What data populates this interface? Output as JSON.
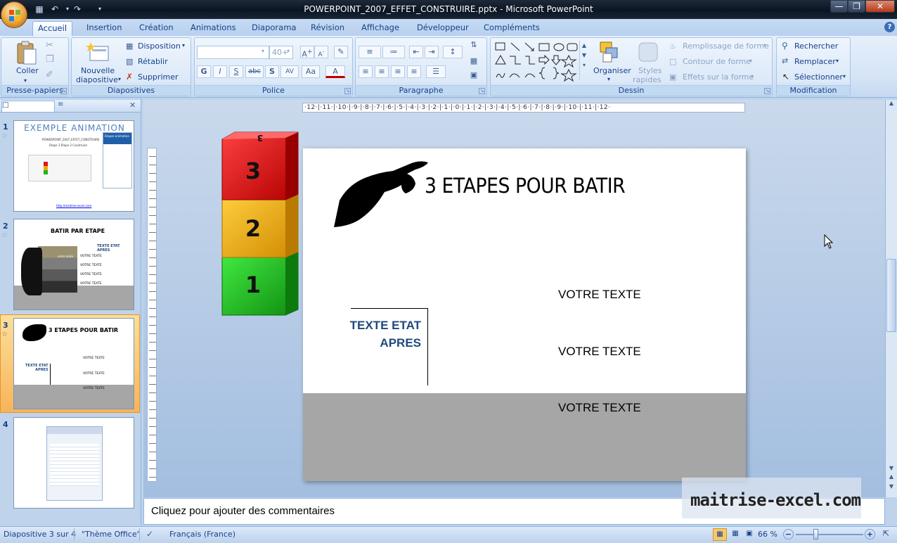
{
  "window": {
    "title": "POWERPOINT_2007_EFFET_CONSTRUIRE.pptx - Microsoft PowerPoint"
  },
  "tabs": [
    "Accueil",
    "Insertion",
    "Création",
    "Animations",
    "Diaporama",
    "Révision",
    "Affichage",
    "Développeur",
    "Compléments"
  ],
  "ribbon": {
    "clipboard": {
      "label": "Presse-papiers",
      "paste": "Coller"
    },
    "slides": {
      "label": "Diapositives",
      "new_slide_1": "Nouvelle",
      "new_slide_2": "diapositive",
      "layout": "Disposition",
      "reset": "Rétablir",
      "delete": "Supprimer"
    },
    "font": {
      "label": "Police",
      "size": "40+"
    },
    "paragraph": {
      "label": "Paragraphe"
    },
    "drawing": {
      "label": "Dessin",
      "arrange": "Organiser",
      "styles_1": "Styles",
      "styles_2": "rapides",
      "fill": "Remplissage de forme",
      "outline": "Contour de forme",
      "effects": "Effets sur la forme"
    },
    "editing": {
      "label": "Modification",
      "find": "Rechercher",
      "replace": "Remplacer",
      "select": "Sélectionner"
    }
  },
  "thumbnails": {
    "t1": {
      "num": "1",
      "title": "EXEMPLE ANIMATION",
      "sub1": "POWERPOINT_2007_EFFET_CONSTRUIRE",
      "sub2": "Etape  1  Etape  2  Construire",
      "box": "Etapes animation",
      "link": "http://maitrise-excel.com"
    },
    "t2": {
      "num": "2",
      "title": "BATIR PAR ETAPE",
      "right": "TEXTE ETAT APRES",
      "items": [
        "VOTRE TEXTE",
        "VOTRE TEXTE",
        "VOTRE TEXTE",
        "VOTRE TEXTE"
      ],
      "block": "votre texte"
    },
    "t3": {
      "num": "3",
      "title": "3 ETAPES POUR BATIR",
      "left1": "TEXTE ETAT",
      "left2": "APRES",
      "items": [
        "VOTRE TEXTE",
        "VOTRE TEXTE",
        "VOTRE TEXTE"
      ]
    },
    "t4": {
      "num": "4"
    }
  },
  "slide": {
    "title": "3 ETAPES POUR BATIR",
    "left_text_1": "TEXTE ETAT",
    "left_text_2": "APRES",
    "text1": "VOTRE TEXTE",
    "text2": "VOTRE TEXTE",
    "text3": "VOTRE TEXTE",
    "cubes": [
      "3",
      "2",
      "1"
    ]
  },
  "ruler": {
    "h": "·12·|·11·|·10·|·9·|·8·|·7·|·6·|·5·|·4·|·3·|·2·|·1·|·0·|·1·|·2·|·3·|·4·|·5·|·6·|·7·|·8·|·9·|·10·|·11·|·12·"
  },
  "notes": {
    "placeholder": "Cliquez pour ajouter des commentaires"
  },
  "status": {
    "slide": "Diapositive 3 sur 4",
    "theme": "\"Thème Office\"",
    "language": "Français (France)",
    "zoom": "66 %"
  },
  "watermark": "maitrise-excel.com",
  "colors": {
    "accent_blue": "#1f497d",
    "cube_red": "#e0121b",
    "cube_orange": "#f0a800",
    "cube_green": "#1db51d",
    "floor": "#a6a6a6"
  }
}
